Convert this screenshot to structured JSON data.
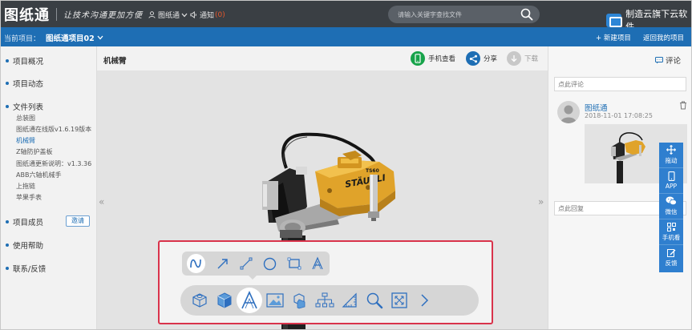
{
  "topbar": {
    "logo": "图纸通",
    "slogan": "让技术沟通更加方便",
    "user": "图纸通",
    "notice_label": "通知",
    "notice_count": "(0)",
    "search_placeholder": "请输入关键字查找文件",
    "brand": "制造云旗下云软件"
  },
  "projbar": {
    "label": "当前项目：",
    "project": "图纸通项目02",
    "new_project": "+ 新建项目",
    "back": "返回我的项目"
  },
  "sidebar": {
    "overview": "项目概况",
    "activity": "项目动态",
    "files": "文件列表",
    "file_items": [
      "总装图",
      "图纸通在线版v1.6.19版本",
      "机械臂",
      "Z轴防护盖板",
      "图纸通更新说明：v1.3.36",
      "ABB六轴机械手",
      "上拖链",
      "苹果手表"
    ],
    "active_index": 2,
    "members": "项目成员",
    "invite": "邀请",
    "help": "使用帮助",
    "contact": "联系/反馈"
  },
  "main": {
    "title": "机械臂",
    "mobile_view": "手机查看",
    "share": "分享",
    "download": "下载",
    "model_brand_text": "STÄUBLI",
    "model_code": "TS60",
    "colors": {
      "mobile": "#17a34a",
      "share": "#1e6eb4",
      "download": "#c8c8c8",
      "highlight": "#d9334b"
    }
  },
  "toolbar": {
    "top_tools": [
      "freehand-icon",
      "arrow-icon",
      "line-icon",
      "circle-icon",
      "rectangle-icon",
      "text-icon"
    ],
    "bottom_tools": [
      "iso-view-icon",
      "cube-view-icon",
      "annotate-text-icon",
      "image-icon",
      "explode-icon",
      "tree-icon",
      "measure-icon",
      "zoom-icon",
      "fit-icon",
      "next-icon"
    ],
    "selected_top": "freehand-icon",
    "selected_bottom": "annotate-text-icon"
  },
  "rpanel": {
    "tab": "评论",
    "comment_placeholder": "点此评论",
    "comment_user": "图纸通",
    "comment_time": "2018-11-01 17:08:25",
    "reply_placeholder": "点此回复"
  },
  "floatbar": {
    "items": [
      "拖动",
      "APP",
      "微信",
      "手机看",
      "反馈"
    ]
  }
}
